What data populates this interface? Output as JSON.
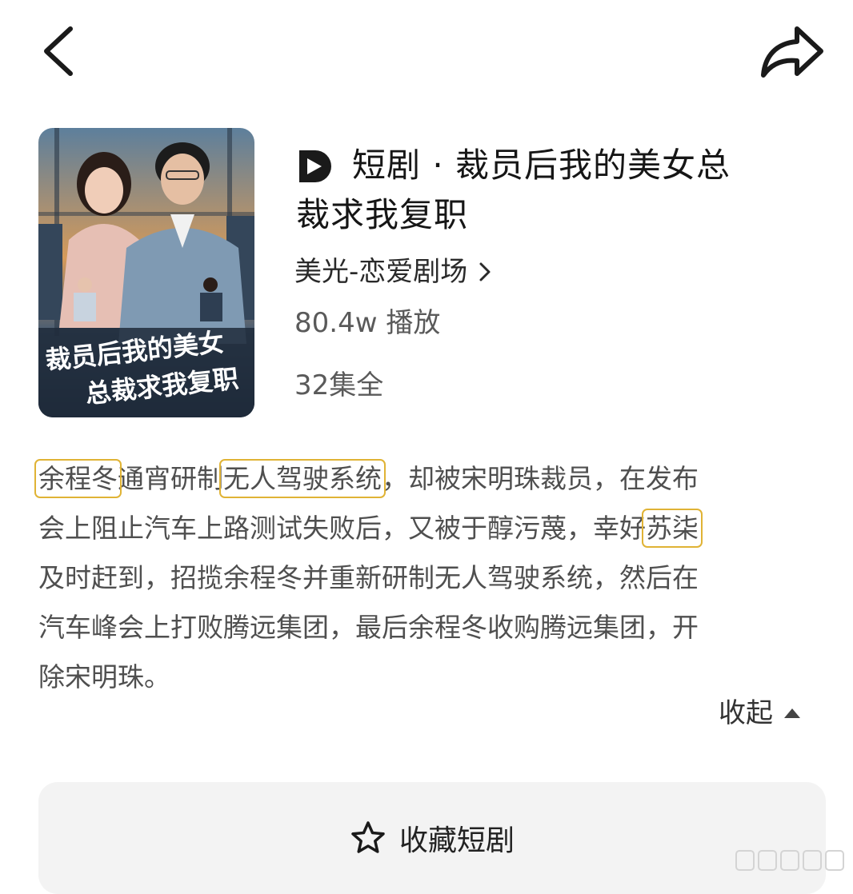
{
  "header": {
    "back_icon": "chevron-left-icon",
    "share_icon": "share-arrow-icon"
  },
  "drama": {
    "poster_title_line1": "裁员后我的美女",
    "poster_title_line2": "总裁求我复职",
    "title_line1": "短剧 · 裁员后我的美女总",
    "title_line2": "裁求我复职",
    "channel": "美光-恋爱剧场",
    "plays": "80.4w 播放",
    "episodes": "32集全"
  },
  "description": {
    "l1_hl1": "余程冬",
    "l1_mid": "通宵研制",
    "l1_hl2": "无人驾驶系统",
    "l1_tail": "，却被宋明珠裁员，在发布",
    "l2_head": "会上阻止汽车上路测试失败后，又被于醇污蔑，幸好",
    "l2_hl": "苏柒",
    "l3": "及时赶到，招揽余程冬并重新研制无人驾驶系统，然后在",
    "l4": "汽车峰会上打败腾远集团，最后余程冬收购腾远集团，开",
    "l5": "除宋明珠。"
  },
  "collapse_label": "收起",
  "favorite_label": "收藏短剧",
  "colors": {
    "highlight_box": "#e0b335",
    "button_bg": "#f3f3f3"
  }
}
